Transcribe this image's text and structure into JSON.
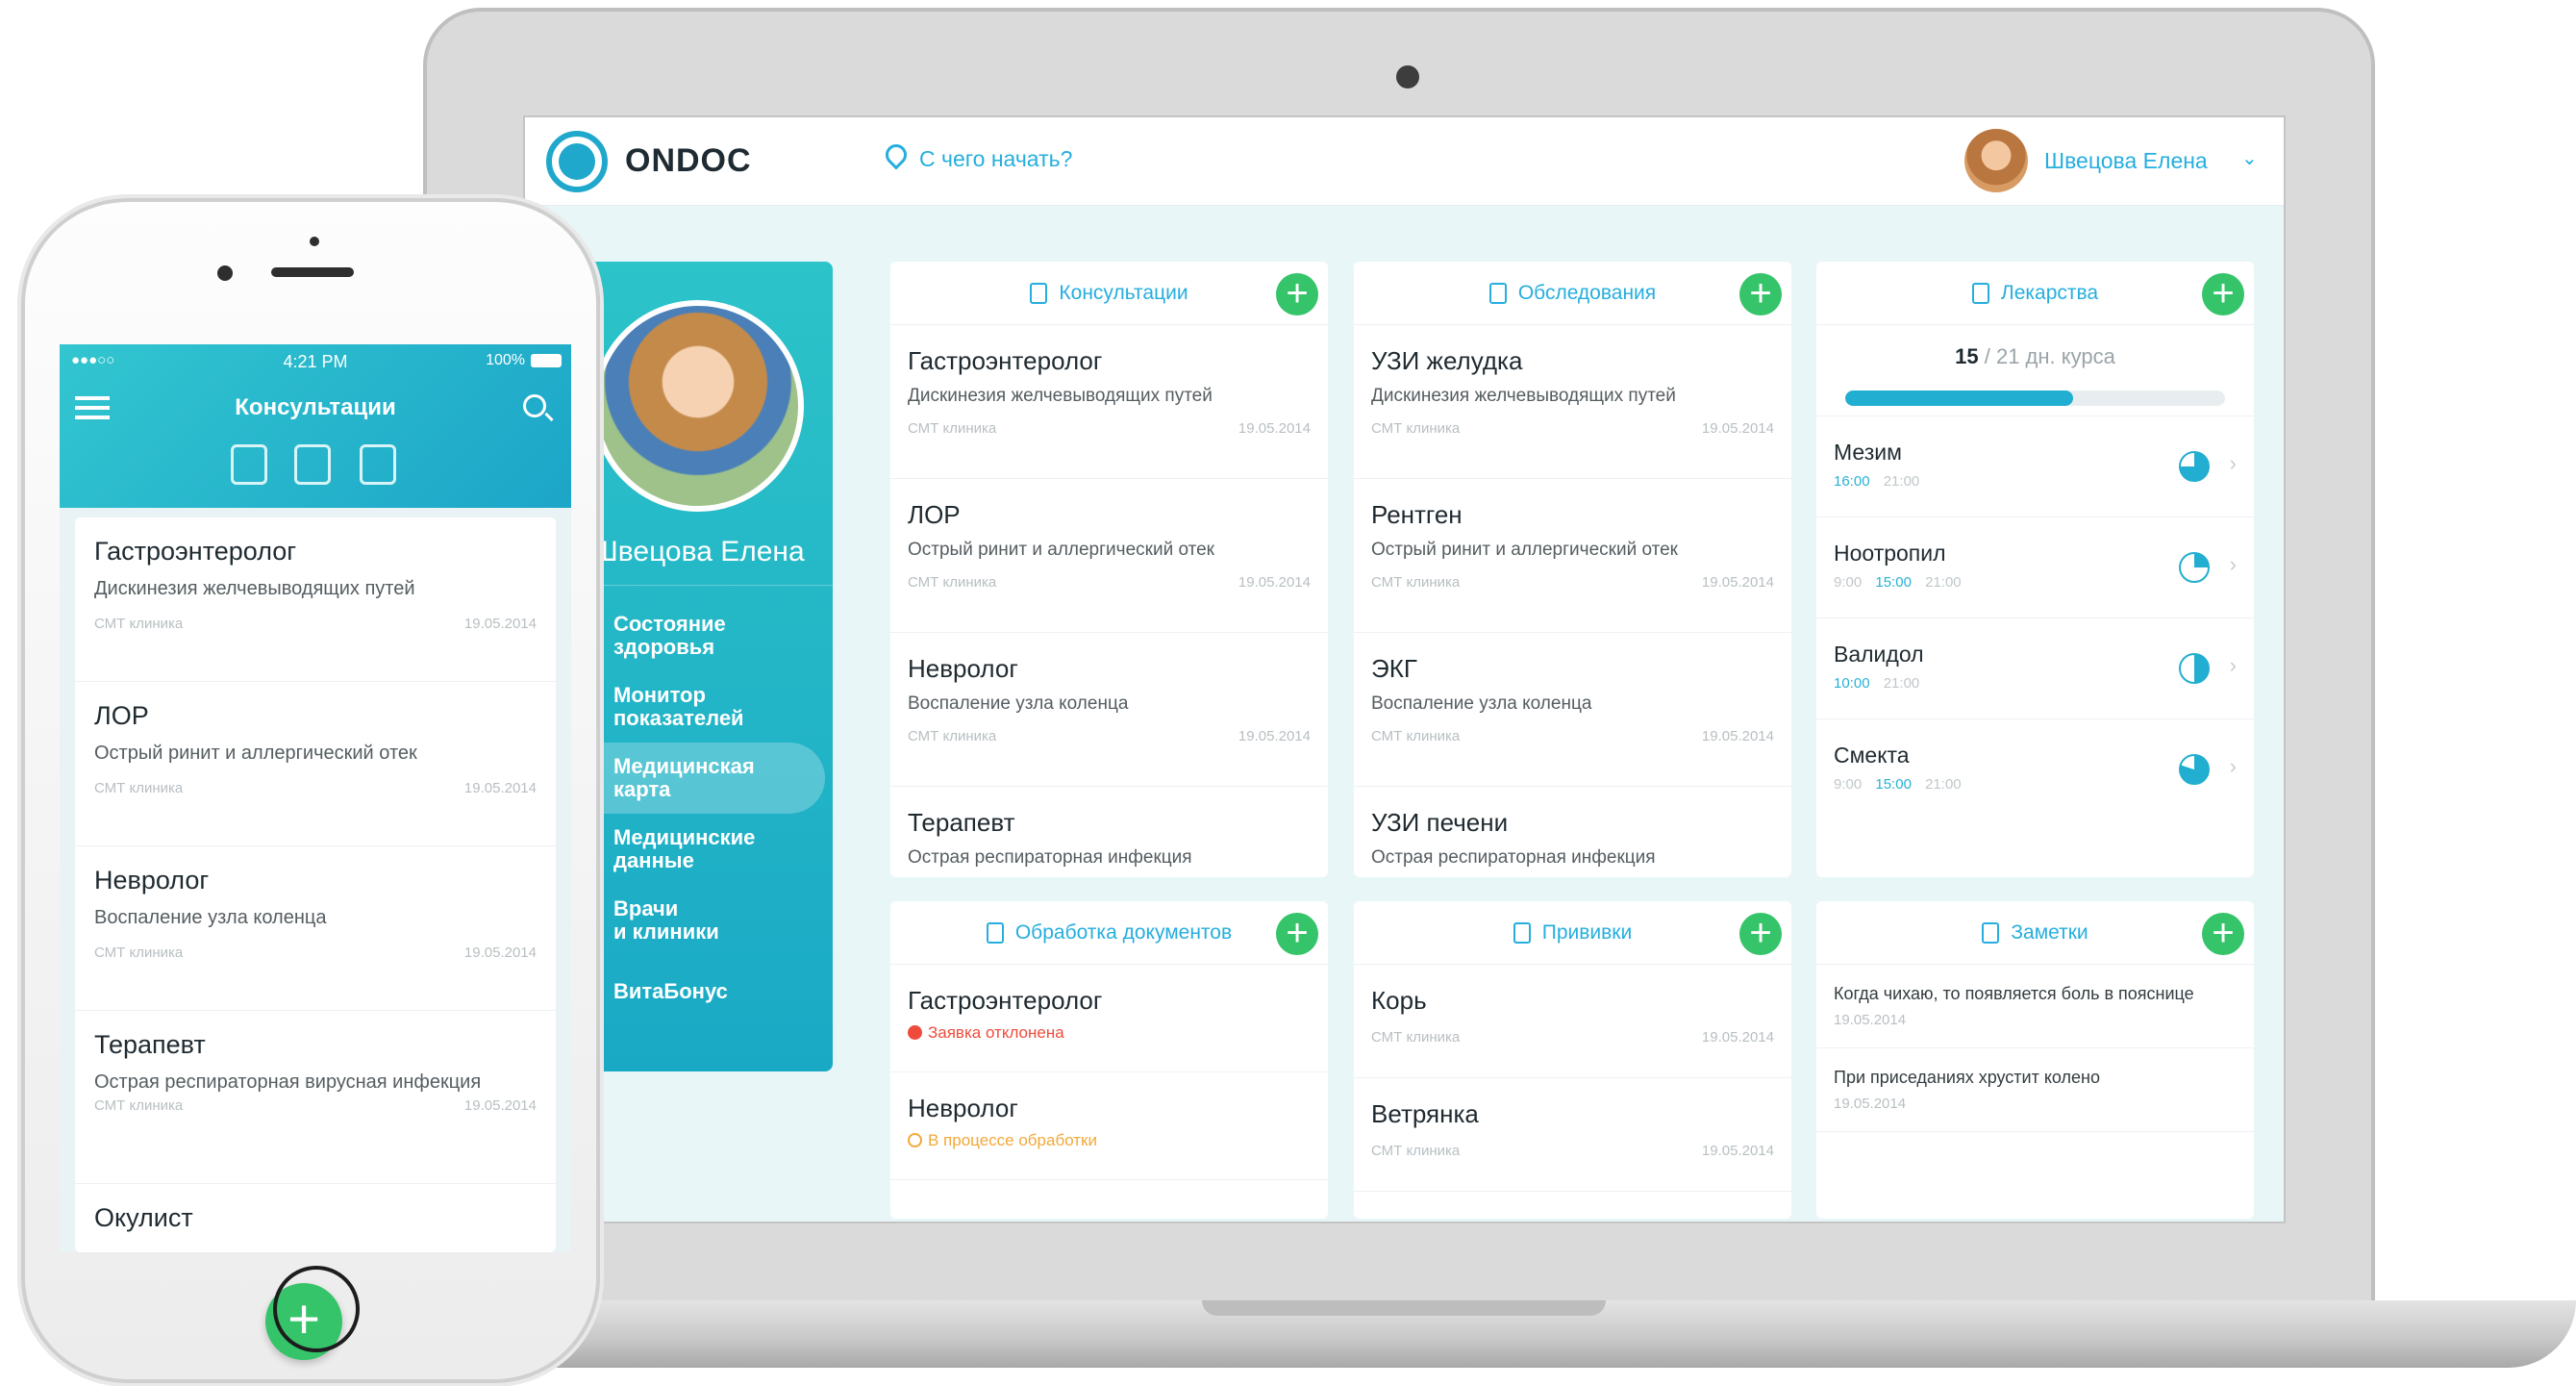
{
  "app": {
    "logo": "ONDOC",
    "start_link": "С чего начать?",
    "user_name": "Швецова Елена",
    "caret": "⌄"
  },
  "sidebar": {
    "profile_name": "Швецова Елена",
    "items": [
      {
        "label": "Состояние\nздоровья"
      },
      {
        "label": "Монитор\nпоказателей"
      },
      {
        "label": "Медицинская\nкарта"
      },
      {
        "label": "Медицинские\nданные"
      },
      {
        "label": "Врачи\nи клиники"
      },
      {
        "label": "ВитаБонус"
      }
    ]
  },
  "consultations": {
    "title": "Консультации",
    "add": "+",
    "items": [
      {
        "title": "Гастроэнтеролог",
        "subtitle": "Дискинезия желчевыводящих путей",
        "clinic": "СМТ клиника",
        "date": "19.05.2014"
      },
      {
        "title": "ЛОР",
        "subtitle": "Острый ринит и аллергический отек",
        "clinic": "СМТ клиника",
        "date": "19.05.2014"
      },
      {
        "title": "Невролог",
        "subtitle": "Воспаление узла коленца",
        "clinic": "СМТ клиника",
        "date": "19.05.2014"
      },
      {
        "title": "Терапевт",
        "subtitle": "Острая респираторная инфекция"
      }
    ]
  },
  "examinations": {
    "title": "Обследования",
    "add": "+",
    "items": [
      {
        "title": "УЗИ желудка",
        "subtitle": "Дискинезия желчевыводящих путей",
        "clinic": "СМТ клиника",
        "date": "19.05.2014"
      },
      {
        "title": "Рентген",
        "subtitle": "Острый ринит и аллергический отек",
        "clinic": "СМТ клиника",
        "date": "19.05.2014"
      },
      {
        "title": "ЭКГ",
        "subtitle": "Воспаление узла коленца",
        "clinic": "СМТ клиника",
        "date": "19.05.2014"
      },
      {
        "title": "УЗИ печени",
        "subtitle": "Острая респираторная инфекция"
      }
    ]
  },
  "medicines": {
    "title": "Лекарства",
    "add": "+",
    "course_current": "15",
    "course_rest": " / 21 дн. курса",
    "progress_fraction": 0.6,
    "items": [
      {
        "name": "Мезим",
        "times": [
          {
            "t": "16:00",
            "hl": true
          },
          {
            "t": "21:00",
            "hl": false
          }
        ]
      },
      {
        "name": "Ноотропил",
        "times": [
          {
            "t": "9:00",
            "hl": false
          },
          {
            "t": "15:00",
            "hl": true
          },
          {
            "t": "21:00",
            "hl": false
          }
        ]
      },
      {
        "name": "Валидол",
        "times": [
          {
            "t": "10:00",
            "hl": true
          },
          {
            "t": "21:00",
            "hl": false
          }
        ]
      },
      {
        "name": "Смекта",
        "times": [
          {
            "t": "9:00",
            "hl": false
          },
          {
            "t": "15:00",
            "hl": true
          },
          {
            "t": "21:00",
            "hl": false
          }
        ]
      }
    ]
  },
  "documents": {
    "title": "Обработка документов",
    "add": "+",
    "items": [
      {
        "title": "Гастроэнтеролог",
        "status": "Заявка отклонена"
      },
      {
        "title": "Невролог",
        "status": "В процессе обработки"
      }
    ]
  },
  "vaccinations": {
    "title": "Прививки",
    "add": "+",
    "items": [
      {
        "title": "Корь",
        "clinic": "СМТ клиника",
        "date": "19.05.2014"
      },
      {
        "title": "Ветрянка",
        "clinic": "СМТ клиника",
        "date": "19.05.2014"
      }
    ]
  },
  "notes": {
    "title": "Заметки",
    "add": "+",
    "items": [
      {
        "text": "Когда чихаю, то появляется боль в пояснице",
        "date": "19.05.2014"
      },
      {
        "text": "При приседаниях хрустит колено",
        "date": "19.05.2014"
      }
    ]
  },
  "phone": {
    "signal": "●●●○○",
    "time": "4:21 PM",
    "battery_text": "100%",
    "title": "Консультации",
    "fab": "+",
    "items": [
      {
        "title": "Гастроэнтеролог",
        "subtitle": "Дискинезия желчевыводящих путей",
        "clinic": "СМТ клиника",
        "date": "19.05.2014"
      },
      {
        "title": "ЛОР",
        "subtitle": "Острый ринит и аллергический отек",
        "clinic": "СМТ клиника",
        "date": "19.05.2014"
      },
      {
        "title": "Невролог",
        "subtitle": "Воспаление узла коленца",
        "clinic": "СМТ клиника",
        "date": "19.05.2014"
      },
      {
        "title": "Терапевт",
        "subtitle": "Острая респираторная вирусная инфекция",
        "clinic": "СМТ клиника",
        "date": "19.05.2014"
      },
      {
        "title": "Окулист"
      }
    ]
  },
  "colors": {
    "accent": "#26aede",
    "teal": "#2cc3c9",
    "add_green": "#36c46a",
    "error": "#ee4b3b",
    "pending": "#f2a83a"
  }
}
